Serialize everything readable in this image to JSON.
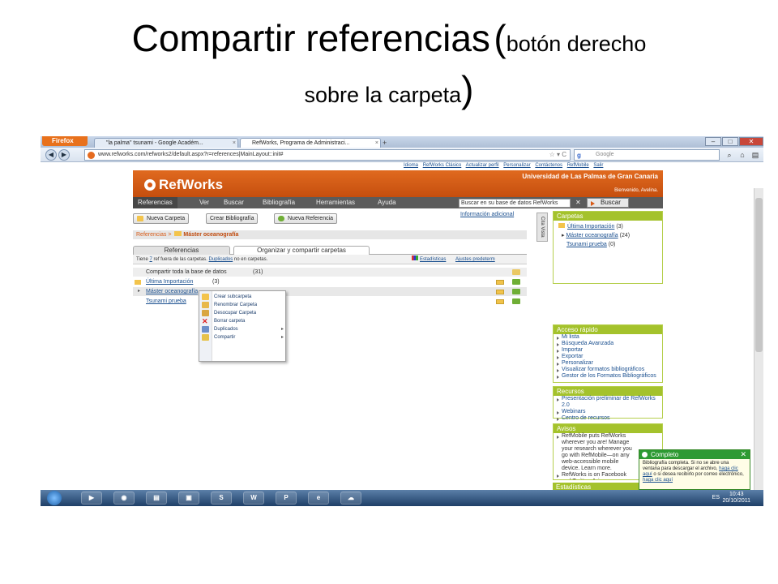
{
  "slide": {
    "title_main": "Compartir referencias",
    "paren_open": "(",
    "title_sub1": "botón derecho",
    "title_sub2": "sobre la carpeta",
    "paren_close": ")"
  },
  "browser": {
    "menu_label": "Firefox",
    "tabs": [
      {
        "label": "\"la palma\" tsunami - Google Académ..."
      },
      {
        "label": "RefWorks, Programa de Administraci..."
      }
    ],
    "new_tab": "+",
    "url": "www.refworks.com/refworks2/default.aspx?r=references|MainLayout::init#",
    "search_placeholder": "Google",
    "min": "–",
    "max": "□",
    "close": "✕"
  },
  "refworks": {
    "top_links": [
      "Idioma",
      "RefWorks Clásico",
      "Actualizar perfil",
      "Personalizar",
      "Contáctenos",
      "RefMobile",
      "Salir"
    ],
    "logo": "RefWorks",
    "institution": "Universidad de Las Palmas de Gran Canaria",
    "welcome": "Bienvenido, Avelina.",
    "menu": [
      "Referencias",
      "Ver",
      "Buscar",
      "Bibliografía",
      "Herramientas",
      "Ayuda"
    ],
    "search_value": "Buscar en su base de datos RefWorks",
    "search_button": "Buscar",
    "buttons": {
      "new_folder": "Nueva Carpeta",
      "create_bib": "Crear Bibliografía",
      "new_ref": "Nueva Referencia"
    },
    "info_link": "Información adicional",
    "breadcrumb": {
      "root": "Referencias",
      "sep": ">",
      "current": "Máster oceanografía"
    },
    "page_tabs": [
      "Referencias",
      "Organizar y compartir carpetas"
    ],
    "toolrow": {
      "text_pre": "Tiene",
      "count": "7",
      "text_mid": "ref fuera de las carpetas.",
      "dupes": "Duplicados",
      "text_post": "no en carpetas.",
      "stats": "Estadísticas",
      "settings": "Ajustes predeterm"
    },
    "rows": [
      {
        "label": "Compartir toda la base de datos",
        "count": "(31)"
      },
      {
        "label": "Última Importación",
        "count": "(3)"
      },
      {
        "label": "Máster oceanografía",
        "count": ""
      },
      {
        "label": "Tsunami prueba",
        "count": ""
      }
    ],
    "context_menu": [
      {
        "label": "Crear subcarpeta"
      },
      {
        "label": "Renombrar Carpeta"
      },
      {
        "label": "Desocupar Carpeta"
      },
      {
        "label": "Borrar carpeta"
      },
      {
        "label": "Duplicados",
        "sub": "▸"
      },
      {
        "label": "Compartir",
        "sub": "▸"
      }
    ],
    "cita_tab": "Cita Vista",
    "carpetas": {
      "header": "Carpetas",
      "items": [
        {
          "label": "Última Importación",
          "count": "(3)"
        },
        {
          "label": "Máster oceanografía",
          "count": "(24)"
        },
        {
          "label": "Tsunami prueba",
          "count": "(0)"
        }
      ]
    },
    "acceso": {
      "header": "Acceso rápido",
      "items": [
        "Mi lista",
        "Búsqueda Avanzada",
        "Importar",
        "Exportar",
        "Personalizar",
        "Visualizar formatos bibliográficos",
        "Gestor de los Formatos Bibliográficos"
      ]
    },
    "recursos": {
      "header": "Recursos",
      "items": [
        "Presentación preliminar de RefWorks 2.0",
        "Webinars",
        "Centro de recursos"
      ]
    },
    "avisos": {
      "header": "Avisos",
      "items": [
        "RefMobile puts RefWorks wherever you are! Manage your research wherever you go with RefMobile—on any web-accessible mobile device. Learn more.",
        "RefWorks is on Facebook and Twitter. Join us now"
      ]
    },
    "estadisticas_header": "Estadísticas"
  },
  "notification": {
    "title": "Completo",
    "close": "✕",
    "body_pre": "Bibliografía completa. Si no se abre una ventana para descargar el archivo,",
    "link1": "haga clic aquí",
    "body_mid": "o si desea recibirlo por correo electrónico,",
    "link2": "haga clic aquí"
  },
  "taskbar": {
    "lang": "ES",
    "time": "10:43",
    "date": "20/10/2011",
    "apps": [
      "▶",
      "◉",
      "▤",
      "▣",
      "S",
      "W",
      "P",
      "e",
      "☁"
    ]
  },
  "colors": {
    "refworks_orange": "#d85a16",
    "sidebar_green": "#a4c22c",
    "notification_green": "#2e9a33"
  }
}
